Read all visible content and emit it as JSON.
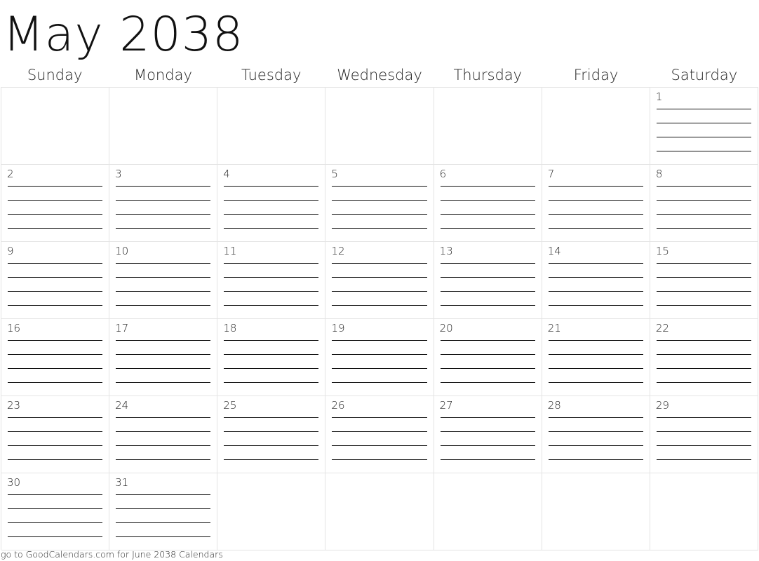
{
  "title": "May 2038",
  "weekdays": [
    "Sunday",
    "Monday",
    "Tuesday",
    "Wednesday",
    "Thursday",
    "Friday",
    "Saturday"
  ],
  "first_weekday_index": 6,
  "days_in_month": 31,
  "lines_per_day": 4,
  "footer": "go to GoodCalendars.com for June 2038 Calendars"
}
